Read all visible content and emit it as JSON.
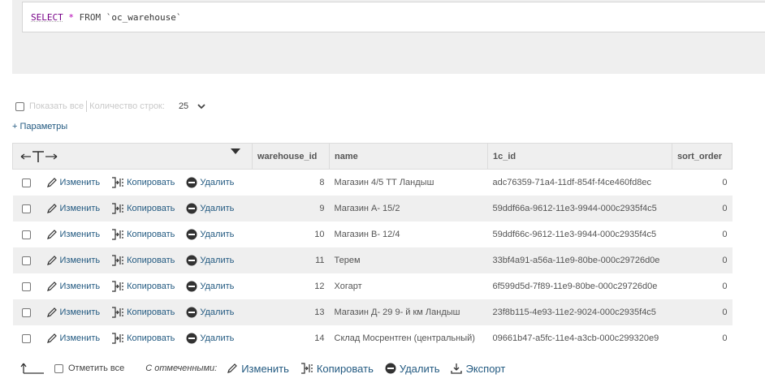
{
  "sql": {
    "select": "SELECT",
    "star": "*",
    "from": "FROM",
    "table": "`oc_warehouse`"
  },
  "controls": {
    "show_all": "Показать все",
    "row_count_label": "Количество строк:",
    "row_count_value": "25"
  },
  "params_link": "+ Параметры",
  "table": {
    "columns": [
      "warehouse_id",
      "name",
      "1c_id",
      "sort_order"
    ],
    "row_actions": {
      "edit": "Изменить",
      "copy": "Копировать",
      "delete": "Удалить"
    },
    "rows": [
      {
        "warehouse_id": "8",
        "name": "Магазин 4/5 ТТ Ландыш",
        "c1_id": "adc76359-71a4-11df-854f-f4ce460fd8ec",
        "sort_order": "0"
      },
      {
        "warehouse_id": "9",
        "name": "Магазин А- 15/2",
        "c1_id": "59ddf66a-9612-11e3-9944-000c2935f4c5",
        "sort_order": "0"
      },
      {
        "warehouse_id": "10",
        "name": "Магазин В- 12/4",
        "c1_id": "59ddf66c-9612-11e3-9944-000c2935f4c5",
        "sort_order": "0"
      },
      {
        "warehouse_id": "11",
        "name": "Терем",
        "c1_id": "33bf4a91-a56a-11e9-80be-000c29726d0e",
        "sort_order": "0"
      },
      {
        "warehouse_id": "12",
        "name": "Хогарт",
        "c1_id": "6f599d5d-7f89-11e9-80be-000c29726d0e",
        "sort_order": "0"
      },
      {
        "warehouse_id": "13",
        "name": "Магазин Д- 29 9- й км Ландыш",
        "c1_id": "23f8b115-4e93-11e2-9024-000c2935f4c5",
        "sort_order": "0"
      },
      {
        "warehouse_id": "14",
        "name": "Склад Мосрентген (центральный)",
        "c1_id": "09661b47-a5fc-11e4-a3cb-000c299320e9",
        "sort_order": "0"
      }
    ]
  },
  "footer": {
    "check_all": "Отметить все",
    "with_selected": "С отмеченными:",
    "edit": "Изменить",
    "copy": "Копировать",
    "delete": "Удалить",
    "export": "Экспорт"
  },
  "colors": {
    "link": "#235a81",
    "header_bg": "#efefef",
    "stripe": "#efefef"
  }
}
